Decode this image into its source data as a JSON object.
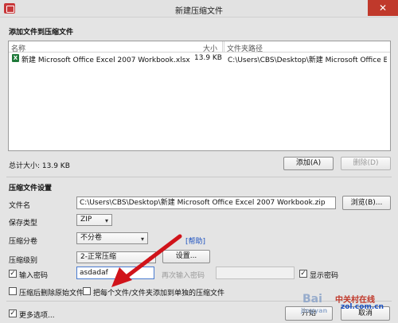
{
  "window": {
    "title": "新建压缩文件",
    "close_glyph": "✕"
  },
  "add_section": {
    "header": "添加文件到压缩文件",
    "columns": {
      "name": "名称",
      "size": "大小",
      "path": "文件夹路径"
    },
    "rows": [
      {
        "name": "新建 Microsoft Office Excel 2007 Workbook.xlsx",
        "size": "13.9 KB",
        "path": "C:\\Users\\CBS\\Desktop\\新建 Microsoft Office Excel 20..."
      }
    ],
    "total_size": "总计大小: 13.9 KB",
    "add_button": "添加(A)",
    "delete_button": "删除(D)"
  },
  "settings": {
    "header": "压缩文件设置",
    "filename_label": "文件名",
    "filename_value": "C:\\Users\\CBS\\Desktop\\新建 Microsoft Office Excel 2007 Workbook.zip",
    "browse_button": "浏览(B)...",
    "savetype_label": "保存类型",
    "savetype_value": "ZIP",
    "split_label": "压缩分卷",
    "split_value": "不分卷",
    "help_link": "[帮助]",
    "level_label": "压缩级别",
    "level_value": "2-正常压缩",
    "settings_button": "设置...",
    "password_checkbox_label": "输入密码",
    "password_value": "asdadaf",
    "reenter_label": "再次输入密码",
    "show_password_label": "显示密码",
    "delete_after_label": "压缩后删除原始文件",
    "each_file_label": "把每个文件/文件夹添加到单独的压缩文件",
    "more_options_label": "更多选项...",
    "start_button": "开始",
    "cancel_button": "取消"
  },
  "watermark": {
    "baidu": "Bai",
    "zol": "中关村在线",
    "zol_domain": "zol.com.cn",
    "jingyan": "jingyan"
  },
  "colors": {
    "arrow": "#d0131a",
    "close": "#c0392b"
  }
}
